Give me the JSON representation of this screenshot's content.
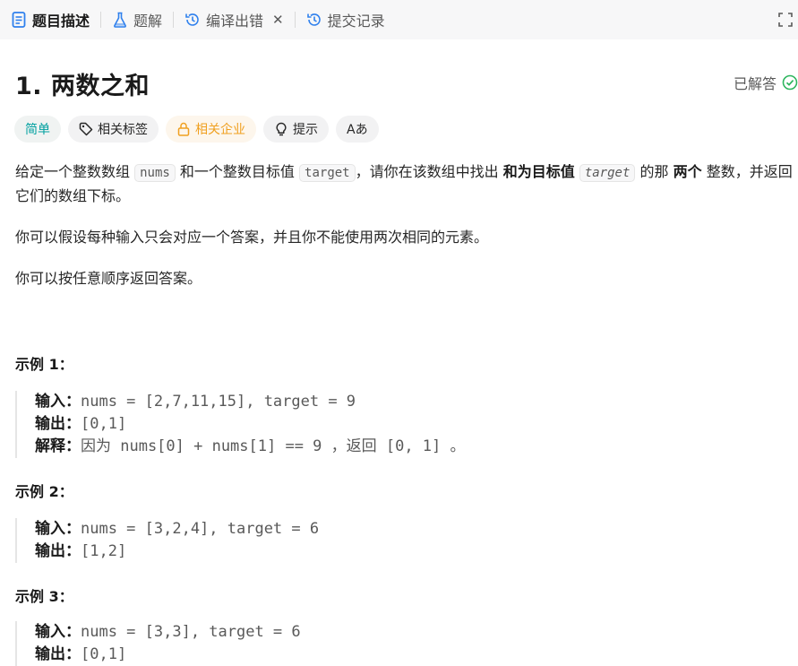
{
  "tabs": [
    {
      "label": "题目描述",
      "icon": "description-icon"
    },
    {
      "label": "题解",
      "icon": "flask-icon"
    },
    {
      "label": "编译出错",
      "icon": "history-icon"
    },
    {
      "label": "提交记录",
      "icon": "history-icon"
    }
  ],
  "problem": {
    "title": "1. 两数之和",
    "status": "已解答"
  },
  "tags": {
    "difficulty": "简单",
    "topics": "相关标签",
    "companies": "相关企业",
    "hint": "提示",
    "translate": "Aあ"
  },
  "description": {
    "p1_a": "给定一个整数数组",
    "p1_code1": "nums",
    "p1_b": "和一个整数目标值",
    "p1_code2": "target",
    "p1_c": "，请你在该数组中找出",
    "p1_bold1": "和为目标值",
    "p1_code3": "target",
    "p1_d": "的那",
    "p1_bold2": "两个",
    "p1_e": "整数，并返回它们的数组下标。",
    "p2": "你可以假设每种输入只会对应一个答案，并且你不能使用两次相同的元素。",
    "p3": "你可以按任意顺序返回答案。"
  },
  "examples": [
    {
      "title": "示例 1：",
      "input_label": "输入：",
      "input": "nums = [2,7,11,15], target = 9",
      "output_label": "输出：",
      "output": "[0,1]",
      "explain_label": "解释：",
      "explain": "因为 nums[0] + nums[1] == 9 ，返回 [0, 1] 。"
    },
    {
      "title": "示例 2：",
      "input_label": "输入：",
      "input": "nums = [3,2,4], target = 6",
      "output_label": "输出：",
      "output": "[1,2]"
    },
    {
      "title": "示例 3：",
      "input_label": "输入：",
      "input": "nums = [3,3], target = 6",
      "output_label": "输出：",
      "output": "[0,1]"
    }
  ],
  "colors": {
    "easy": "#00a0a0",
    "company": "#f0a020",
    "solved_check": "#2db55d",
    "tab_icon_blue": "#2f80ed"
  }
}
